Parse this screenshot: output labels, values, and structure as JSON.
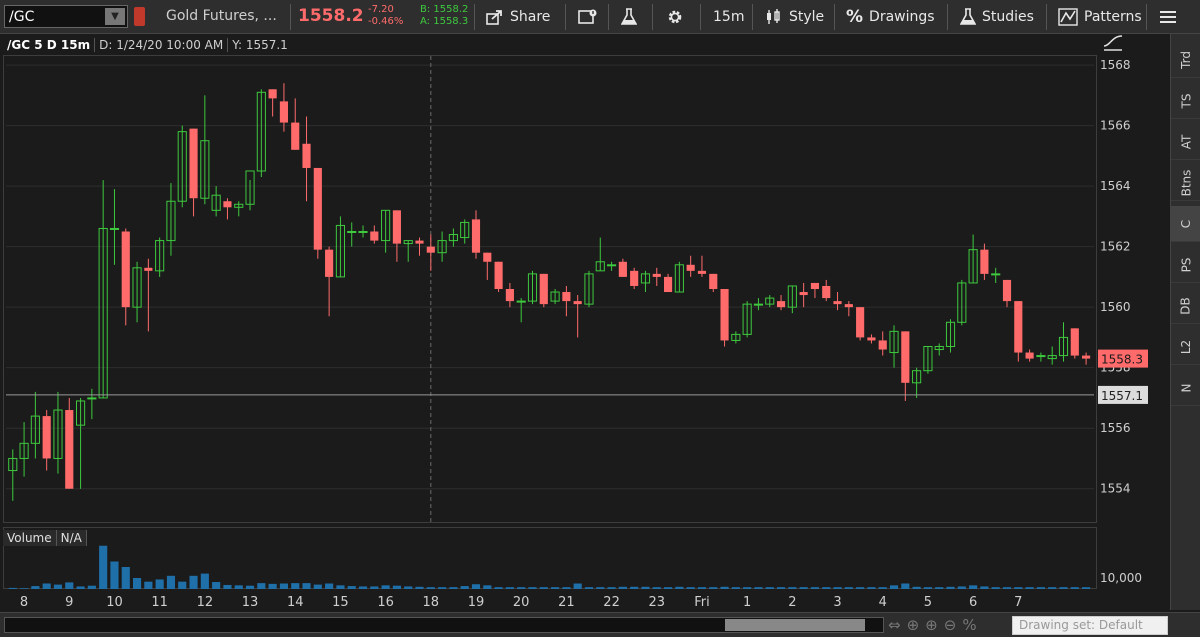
{
  "toolbar": {
    "symbol": "/GC",
    "description": "Gold Futures, ...",
    "last_price": "1558.2",
    "net_change": "-7.20",
    "pct_change": "-0.46%",
    "bid": "B: 1558.2",
    "ask": "A: 1558.3",
    "share_label": "Share",
    "timeframe_label": "15m",
    "style_label": "Style",
    "drawings_label": "Drawings",
    "studies_label": "Studies",
    "patterns_label": "Patterns"
  },
  "chart_header": {
    "symbol_period": "/GC 5 D 15m",
    "date_info": "D: 1/24/20 10:00 AM",
    "y_info": "Y: 1557.1"
  },
  "volume_panel": {
    "label": "Volume",
    "value": "N/A",
    "axis_label": "10,000"
  },
  "side_tabs": [
    {
      "label": "Trd",
      "active": false
    },
    {
      "label": "TS",
      "active": false
    },
    {
      "label": "AT",
      "active": false
    },
    {
      "label": "Btns",
      "active": false
    },
    {
      "label": "C",
      "active": true
    },
    {
      "label": "PS",
      "active": false
    },
    {
      "label": "DB",
      "active": false
    },
    {
      "label": "L2",
      "active": false
    },
    {
      "label": "N",
      "active": false
    }
  ],
  "bottom_bar": {
    "drawing_set": "Drawing set: Default"
  },
  "colors": {
    "up": "#3ec93e",
    "down": "#ff6b6b",
    "background": "#1b1b1b",
    "grid": "#2e2e2e",
    "volume": "#1f6fa8",
    "price_label_bg": "#ff6b6b",
    "crosshair_label_bg": "#dcdcdc"
  },
  "chart_data": {
    "type": "candlestick",
    "ylim": [
      1552.9,
      1568.3
    ],
    "y_ticks": [
      1554,
      1556,
      1558,
      1560,
      1562,
      1564,
      1566,
      1568
    ],
    "x_labels": [
      "8",
      "9",
      "10",
      "11",
      "12",
      "13",
      "14",
      "15",
      "16",
      "18",
      "19",
      "20",
      "21",
      "22",
      "23",
      "Fri",
      "1",
      "2",
      "3",
      "4",
      "5",
      "6",
      "7"
    ],
    "x_label_bar_index": [
      1,
      5,
      9,
      13,
      17,
      21,
      25,
      29,
      33,
      37,
      41,
      45,
      49,
      53,
      57,
      61,
      65,
      69,
      73,
      77,
      81,
      85,
      89
    ],
    "last_price": 1558.3,
    "crosshair_price": 1557.1,
    "crosshair_bar_index": 37,
    "volume_max": 12000,
    "candles": [
      {
        "o": 1554.6,
        "h": 1555.3,
        "l": 1553.6,
        "c": 1555.0,
        "v": 300
      },
      {
        "o": 1555.0,
        "h": 1556.2,
        "l": 1554.4,
        "c": 1555.5,
        "v": 200
      },
      {
        "o": 1555.5,
        "h": 1557.2,
        "l": 1555.0,
        "c": 1556.4,
        "v": 800
      },
      {
        "o": 1556.4,
        "h": 1556.6,
        "l": 1554.6,
        "c": 1555.0,
        "v": 1500
      },
      {
        "o": 1555.0,
        "h": 1557.2,
        "l": 1554.5,
        "c": 1556.6,
        "v": 1200
      },
      {
        "o": 1556.6,
        "h": 1557.0,
        "l": 1554.0,
        "c": 1554.0,
        "v": 1800
      },
      {
        "o": 1556.1,
        "h": 1557.0,
        "l": 1554.0,
        "c": 1556.9,
        "v": 700
      },
      {
        "o": 1557.0,
        "h": 1557.3,
        "l": 1556.3,
        "c": 1557.0,
        "v": 900
      },
      {
        "o": 1557.0,
        "h": 1564.2,
        "l": 1557.0,
        "c": 1562.6,
        "v": 11800
      },
      {
        "o": 1562.6,
        "h": 1563.9,
        "l": 1561.4,
        "c": 1562.6,
        "v": 7500
      },
      {
        "o": 1562.5,
        "h": 1562.6,
        "l": 1559.4,
        "c": 1560.0,
        "v": 6000
      },
      {
        "o": 1560.0,
        "h": 1561.5,
        "l": 1559.5,
        "c": 1561.3,
        "v": 3000
      },
      {
        "o": 1561.3,
        "h": 1561.6,
        "l": 1559.2,
        "c": 1561.2,
        "v": 2000
      },
      {
        "o": 1561.2,
        "h": 1562.3,
        "l": 1561.0,
        "c": 1562.2,
        "v": 2600
      },
      {
        "o": 1562.2,
        "h": 1564.1,
        "l": 1561.7,
        "c": 1563.5,
        "v": 3600
      },
      {
        "o": 1563.5,
        "h": 1566.0,
        "l": 1563.3,
        "c": 1565.8,
        "v": 2000
      },
      {
        "o": 1565.9,
        "h": 1565.9,
        "l": 1563.0,
        "c": 1563.6,
        "v": 3600
      },
      {
        "o": 1563.6,
        "h": 1567.0,
        "l": 1563.4,
        "c": 1565.5,
        "v": 4200
      },
      {
        "o": 1563.2,
        "h": 1564.0,
        "l": 1563.0,
        "c": 1563.7,
        "v": 1900
      },
      {
        "o": 1563.5,
        "h": 1563.6,
        "l": 1562.9,
        "c": 1563.3,
        "v": 1100
      },
      {
        "o": 1563.3,
        "h": 1563.5,
        "l": 1563.0,
        "c": 1563.4,
        "v": 1000
      },
      {
        "o": 1563.4,
        "h": 1564.2,
        "l": 1563.2,
        "c": 1564.5,
        "v": 900
      },
      {
        "o": 1564.5,
        "h": 1567.2,
        "l": 1564.3,
        "c": 1567.1,
        "v": 1600
      },
      {
        "o": 1567.2,
        "h": 1567.2,
        "l": 1566.3,
        "c": 1566.9,
        "v": 1400
      },
      {
        "o": 1566.8,
        "h": 1567.4,
        "l": 1565.8,
        "c": 1566.1,
        "v": 1500
      },
      {
        "o": 1566.1,
        "h": 1566.9,
        "l": 1565.2,
        "c": 1565.2,
        "v": 1600
      },
      {
        "o": 1565.4,
        "h": 1566.3,
        "l": 1563.5,
        "c": 1564.6,
        "v": 1600
      },
      {
        "o": 1564.6,
        "h": 1564.6,
        "l": 1561.6,
        "c": 1561.9,
        "v": 1200
      },
      {
        "o": 1561.9,
        "h": 1562.0,
        "l": 1559.7,
        "c": 1561.0,
        "v": 1500
      },
      {
        "o": 1561.0,
        "h": 1563.0,
        "l": 1561.0,
        "c": 1562.7,
        "v": 1000
      },
      {
        "o": 1562.5,
        "h": 1562.8,
        "l": 1562.0,
        "c": 1562.5,
        "v": 800
      },
      {
        "o": 1562.5,
        "h": 1562.7,
        "l": 1562.3,
        "c": 1562.5,
        "v": 700
      },
      {
        "o": 1562.5,
        "h": 1562.7,
        "l": 1562.1,
        "c": 1562.2,
        "v": 700
      },
      {
        "o": 1562.2,
        "h": 1563.2,
        "l": 1561.8,
        "c": 1563.2,
        "v": 1000
      },
      {
        "o": 1563.2,
        "h": 1563.2,
        "l": 1561.5,
        "c": 1562.1,
        "v": 900
      },
      {
        "o": 1562.1,
        "h": 1562.2,
        "l": 1561.5,
        "c": 1562.2,
        "v": 700
      },
      {
        "o": 1562.2,
        "h": 1562.3,
        "l": 1561.7,
        "c": 1562.1,
        "v": 600
      },
      {
        "o": 1562.0,
        "h": 1562.4,
        "l": 1561.2,
        "c": 1561.8,
        "v": 500
      },
      {
        "o": 1561.8,
        "h": 1562.5,
        "l": 1561.5,
        "c": 1562.2,
        "v": 500
      },
      {
        "o": 1562.2,
        "h": 1562.6,
        "l": 1562.0,
        "c": 1562.4,
        "v": 500
      },
      {
        "o": 1562.3,
        "h": 1562.9,
        "l": 1562.1,
        "c": 1562.8,
        "v": 800
      },
      {
        "o": 1562.9,
        "h": 1563.2,
        "l": 1561.6,
        "c": 1561.8,
        "v": 1300
      },
      {
        "o": 1561.8,
        "h": 1561.8,
        "l": 1560.9,
        "c": 1561.5,
        "v": 1000
      },
      {
        "o": 1561.5,
        "h": 1561.5,
        "l": 1560.5,
        "c": 1560.6,
        "v": 500
      },
      {
        "o": 1560.6,
        "h": 1560.8,
        "l": 1560.0,
        "c": 1560.2,
        "v": 500
      },
      {
        "o": 1560.2,
        "h": 1560.3,
        "l": 1559.5,
        "c": 1560.2,
        "v": 500
      },
      {
        "o": 1560.2,
        "h": 1561.2,
        "l": 1560.1,
        "c": 1561.1,
        "v": 500
      },
      {
        "o": 1561.1,
        "h": 1561.1,
        "l": 1560.0,
        "c": 1560.1,
        "v": 500
      },
      {
        "o": 1560.2,
        "h": 1560.6,
        "l": 1560.1,
        "c": 1560.5,
        "v": 500
      },
      {
        "o": 1560.5,
        "h": 1560.7,
        "l": 1559.7,
        "c": 1560.2,
        "v": 500
      },
      {
        "o": 1560.2,
        "h": 1560.4,
        "l": 1559.0,
        "c": 1560.1,
        "v": 1500
      },
      {
        "o": 1560.1,
        "h": 1561.2,
        "l": 1560.0,
        "c": 1561.1,
        "v": 500
      },
      {
        "o": 1561.2,
        "h": 1562.3,
        "l": 1561.2,
        "c": 1561.5,
        "v": 500
      },
      {
        "o": 1561.4,
        "h": 1561.5,
        "l": 1561.2,
        "c": 1561.4,
        "v": 500
      },
      {
        "o": 1561.5,
        "h": 1561.6,
        "l": 1561.0,
        "c": 1561.0,
        "v": 600
      },
      {
        "o": 1561.2,
        "h": 1561.3,
        "l": 1560.6,
        "c": 1560.7,
        "v": 600
      },
      {
        "o": 1560.8,
        "h": 1561.2,
        "l": 1560.5,
        "c": 1561.1,
        "v": 600
      },
      {
        "o": 1561.1,
        "h": 1561.3,
        "l": 1560.7,
        "c": 1561.0,
        "v": 500
      },
      {
        "o": 1561.0,
        "h": 1561.1,
        "l": 1560.5,
        "c": 1560.5,
        "v": 500
      },
      {
        "o": 1560.5,
        "h": 1561.5,
        "l": 1560.5,
        "c": 1561.4,
        "v": 600
      },
      {
        "o": 1561.4,
        "h": 1561.7,
        "l": 1561.0,
        "c": 1561.2,
        "v": 500
      },
      {
        "o": 1561.2,
        "h": 1561.7,
        "l": 1561.0,
        "c": 1561.1,
        "v": 500
      },
      {
        "o": 1561.1,
        "h": 1561.1,
        "l": 1560.5,
        "c": 1560.6,
        "v": 500
      },
      {
        "o": 1560.6,
        "h": 1560.6,
        "l": 1558.7,
        "c": 1558.9,
        "v": 600
      },
      {
        "o": 1558.9,
        "h": 1559.2,
        "l": 1558.8,
        "c": 1559.1,
        "v": 500
      },
      {
        "o": 1559.1,
        "h": 1560.2,
        "l": 1559.0,
        "c": 1560.1,
        "v": 500
      },
      {
        "o": 1560.1,
        "h": 1560.3,
        "l": 1559.9,
        "c": 1560.1,
        "v": 500
      },
      {
        "o": 1560.1,
        "h": 1560.4,
        "l": 1560.0,
        "c": 1560.3,
        "v": 500
      },
      {
        "o": 1560.2,
        "h": 1560.4,
        "l": 1559.9,
        "c": 1560.0,
        "v": 500
      },
      {
        "o": 1560.0,
        "h": 1560.7,
        "l": 1559.8,
        "c": 1560.7,
        "v": 500
      },
      {
        "o": 1560.5,
        "h": 1560.8,
        "l": 1560.0,
        "c": 1560.4,
        "v": 500
      },
      {
        "o": 1560.8,
        "h": 1560.8,
        "l": 1560.3,
        "c": 1560.6,
        "v": 500
      },
      {
        "o": 1560.7,
        "h": 1560.9,
        "l": 1560.2,
        "c": 1560.3,
        "v": 500
      },
      {
        "o": 1560.2,
        "h": 1560.5,
        "l": 1559.9,
        "c": 1560.1,
        "v": 500
      },
      {
        "o": 1560.1,
        "h": 1560.2,
        "l": 1559.7,
        "c": 1560.0,
        "v": 500
      },
      {
        "o": 1560.0,
        "h": 1560.0,
        "l": 1558.9,
        "c": 1559.0,
        "v": 500
      },
      {
        "o": 1559.0,
        "h": 1559.1,
        "l": 1558.8,
        "c": 1558.9,
        "v": 500
      },
      {
        "o": 1558.9,
        "h": 1559.2,
        "l": 1558.4,
        "c": 1558.6,
        "v": 500
      },
      {
        "o": 1558.5,
        "h": 1559.4,
        "l": 1558.0,
        "c": 1559.2,
        "v": 1000
      },
      {
        "o": 1559.2,
        "h": 1559.2,
        "l": 1556.9,
        "c": 1557.5,
        "v": 1500
      },
      {
        "o": 1557.5,
        "h": 1558.0,
        "l": 1557.0,
        "c": 1557.9,
        "v": 600
      },
      {
        "o": 1557.9,
        "h": 1558.7,
        "l": 1557.8,
        "c": 1558.7,
        "v": 500
      },
      {
        "o": 1558.6,
        "h": 1558.8,
        "l": 1558.4,
        "c": 1558.7,
        "v": 500
      },
      {
        "o": 1558.7,
        "h": 1559.6,
        "l": 1558.5,
        "c": 1559.5,
        "v": 600
      },
      {
        "o": 1559.5,
        "h": 1560.9,
        "l": 1559.4,
        "c": 1560.8,
        "v": 700
      },
      {
        "o": 1560.8,
        "h": 1562.4,
        "l": 1560.8,
        "c": 1561.9,
        "v": 1000
      },
      {
        "o": 1561.9,
        "h": 1562.1,
        "l": 1560.9,
        "c": 1561.1,
        "v": 700
      },
      {
        "o": 1561.1,
        "h": 1561.3,
        "l": 1560.8,
        "c": 1561.1,
        "v": 500
      },
      {
        "o": 1560.9,
        "h": 1560.9,
        "l": 1560.0,
        "c": 1560.2,
        "v": 500
      },
      {
        "o": 1560.2,
        "h": 1560.2,
        "l": 1558.2,
        "c": 1558.5,
        "v": 500
      },
      {
        "o": 1558.5,
        "h": 1558.6,
        "l": 1558.2,
        "c": 1558.3,
        "v": 500
      },
      {
        "o": 1558.4,
        "h": 1558.5,
        "l": 1558.2,
        "c": 1558.4,
        "v": 500
      },
      {
        "o": 1558.3,
        "h": 1558.7,
        "l": 1558.1,
        "c": 1558.4,
        "v": 500
      },
      {
        "o": 1558.4,
        "h": 1559.5,
        "l": 1558.2,
        "c": 1559.0,
        "v": 500
      },
      {
        "o": 1559.3,
        "h": 1559.3,
        "l": 1558.3,
        "c": 1558.4,
        "v": 500
      },
      {
        "o": 1558.4,
        "h": 1558.5,
        "l": 1558.1,
        "c": 1558.3,
        "v": 500
      }
    ]
  }
}
